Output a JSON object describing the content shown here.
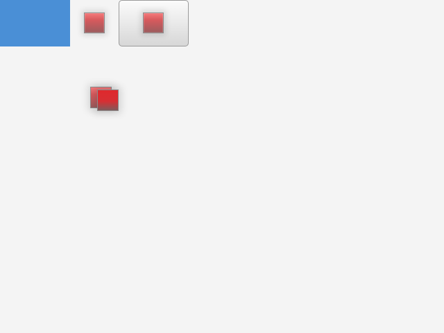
{
  "icons": {
    "primary": "red-square-icon",
    "secondary": "red-square-icon",
    "stacked_front": "red-square-icon",
    "stacked_back": "red-square-icon"
  },
  "colors": {
    "background": "#f4f4f4",
    "panel": "#4a8fd6",
    "icon_red": "#d75a5d"
  }
}
